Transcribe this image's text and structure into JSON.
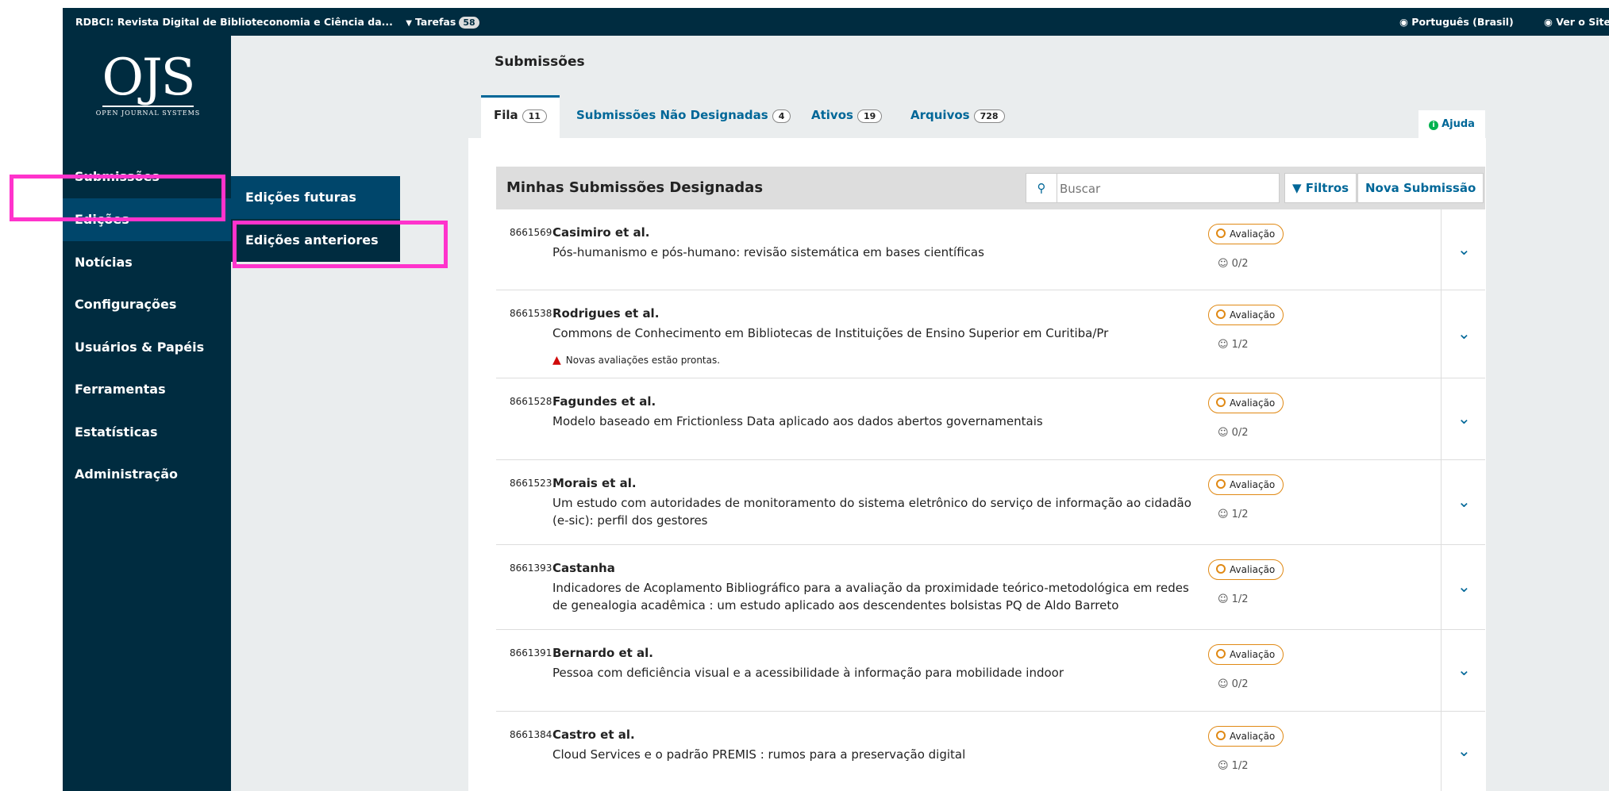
{
  "topbar": {
    "journal_title": "RDBCI: Revista Digital de Biblioteconomia e Ciência da...",
    "tasks_label": "Tarefas",
    "tasks_count": "58",
    "language": "Português (Brasil)",
    "view_site": "Ver o Site"
  },
  "logo": {
    "big": "OJS",
    "small": "OPEN JOURNAL SYSTEMS"
  },
  "sidebar": {
    "items": [
      {
        "label": "Submissões"
      },
      {
        "label": "Edições"
      },
      {
        "label": "Notícias"
      },
      {
        "label": "Configurações"
      },
      {
        "label": "Usuários & Papéis"
      },
      {
        "label": "Ferramentas"
      },
      {
        "label": "Estatísticas"
      },
      {
        "label": "Administração"
      }
    ],
    "submenu": [
      {
        "label": "Edições futuras"
      },
      {
        "label": "Edições anteriores"
      }
    ]
  },
  "main": {
    "page_title": "Submissões",
    "tabs": [
      {
        "label": "Fila",
        "count": "11"
      },
      {
        "label": "Submissões Não Designadas",
        "count": "4"
      },
      {
        "label": "Ativos",
        "count": "19"
      },
      {
        "label": "Arquivos",
        "count": "728"
      }
    ],
    "help_label": "Ajuda",
    "list_title": "Minhas Submissões Designadas",
    "search_placeholder": "Buscar",
    "filters_label": "Filtros",
    "new_submission_label": "Nova Submissão",
    "submissions": [
      {
        "id": "8661569",
        "author": "Casimiro et al.",
        "title": "Pós-humanismo e pós-humano: revisão sistemática em bases científicas",
        "stage": "Avaliação",
        "reviews": "0/2"
      },
      {
        "id": "8661538",
        "author": "Rodrigues et al.",
        "title": "Commons de Conhecimento em Bibliotecas de Instituições de Ensino Superior em Curitiba/Pr",
        "notice": "Novas avaliações estão prontas.",
        "stage": "Avaliação",
        "reviews": "1/2"
      },
      {
        "id": "8661528",
        "author": "Fagundes et al.",
        "title": "Modelo baseado em Frictionless Data aplicado aos dados abertos governamentais",
        "stage": "Avaliação",
        "reviews": "0/2"
      },
      {
        "id": "8661523",
        "author": "Morais et al.",
        "title": "Um estudo com autoridades de monitoramento do sistema eletrônico do serviço de informação ao cidadão (e-sic): perfil dos gestores",
        "stage": "Avaliação",
        "reviews": "1/2"
      },
      {
        "id": "8661393",
        "author": "Castanha",
        "title": "Indicadores de Acoplamento Bibliográfico para a avaliação da proximidade teórico-metodológica em redes de genealogia acadêmica : um estudo aplicado aos descendentes bolsistas PQ de Aldo Barreto",
        "stage": "Avaliação",
        "reviews": "1/2"
      },
      {
        "id": "8661391",
        "author": "Bernardo et al.",
        "title": "Pessoa com deficiência visual e a acessibilidade à informação para mobilidade indoor",
        "stage": "Avaliação",
        "reviews": "0/2"
      },
      {
        "id": "8661384",
        "author": "Castro et al.",
        "title": "Cloud Services e o padrão PREMIS : rumos para a preservação digital",
        "stage": "Avaliação",
        "reviews": "1/2"
      }
    ]
  },
  "colors": {
    "nav_bg": "#002c40",
    "nav_active": "#00466b",
    "link": "#006798",
    "highlight": "#ff33cc",
    "stage_border": "#e08914"
  }
}
